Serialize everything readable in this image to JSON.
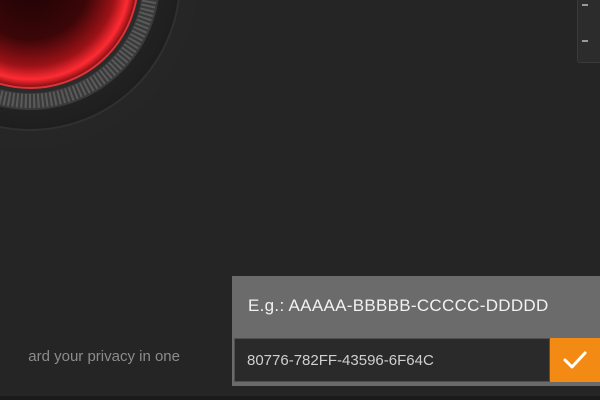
{
  "tagline": "ard your privacy in one",
  "license": {
    "example_label": "E.g.: AAAAA-BBBBB-CCCCC-DDDDD",
    "key_value": "80776-782FF-43596-6F64C"
  },
  "icons": {
    "confirm": "checkmark-icon",
    "dial": "power-dial-icon"
  },
  "colors": {
    "accent": "#f28a14",
    "dial_red": "#e0242b",
    "panel": "#6b6b6b",
    "background": "#252525"
  }
}
